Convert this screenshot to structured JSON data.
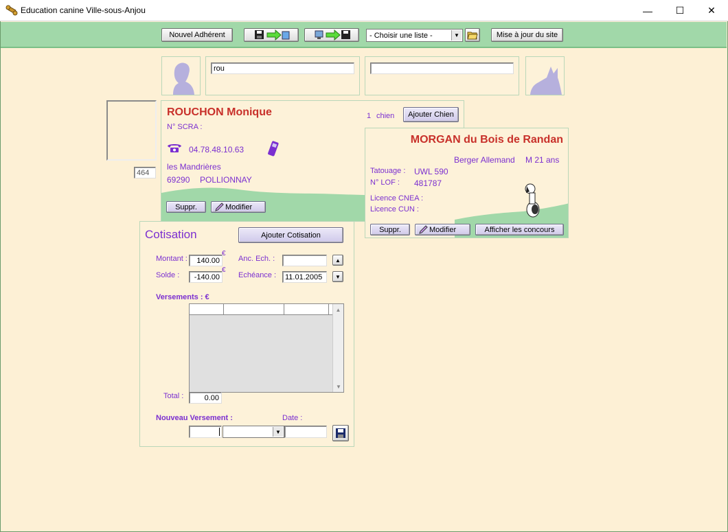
{
  "window": {
    "title": "Education canine Ville-sous-Anjou",
    "controls": {
      "minimize": "—",
      "maximize": "☐",
      "close": "✕"
    }
  },
  "toolbar": {
    "new_member": "Nouvel Adhérent",
    "list_select": "- Choisir une liste -",
    "update_site": "Mise à jour du site"
  },
  "search": {
    "owner_value": "rou",
    "dog_value": ""
  },
  "member": {
    "photo_id": "464",
    "name": "ROUCHON Monique",
    "scra_label": "N° SCRA :",
    "phone": "04.78.48.10.63",
    "address_line": "les Mandrières",
    "postcode": "69290",
    "city": "POLLIONNAY",
    "dog_count": "1",
    "dog_count_label": "chien",
    "add_dog": "Ajouter Chien",
    "delete": "Suppr.",
    "edit": "Modifier"
  },
  "dog": {
    "name": "MORGAN du Bois de Randan",
    "breed": "Berger Allemand",
    "sex_age": "M  21 ans",
    "tattoo_label": "Tatouage :",
    "tattoo": "UWL 590",
    "lof_label": "N° LOF :",
    "lof": "481787",
    "cnea_label": "Licence CNEA :",
    "cun_label": "Licence CUN :",
    "delete": "Suppr.",
    "edit": "Modifier",
    "contests": "Afficher les concours"
  },
  "cotisation": {
    "title": "Cotisation",
    "add": "Ajouter Cotisation",
    "montant_label": "Montant :",
    "montant": "140.00",
    "solde_label": "Solde :",
    "solde": "-140.00",
    "euro": "€",
    "anc_ech_label": "Anc. Ech. :",
    "anc_ech": "",
    "echeance_label": "Echéance :",
    "echeance": "11.01.2005",
    "versements_label": "Versements : €",
    "total_label": "Total :",
    "total": "0.00",
    "new_payment_label": "Nouveau Versement :",
    "date_label": "Date :"
  },
  "icons": {
    "phone": "phone-icon",
    "mobile": "mobile-icon",
    "floppy": "floppy-icon",
    "folder": "folder-icon"
  }
}
